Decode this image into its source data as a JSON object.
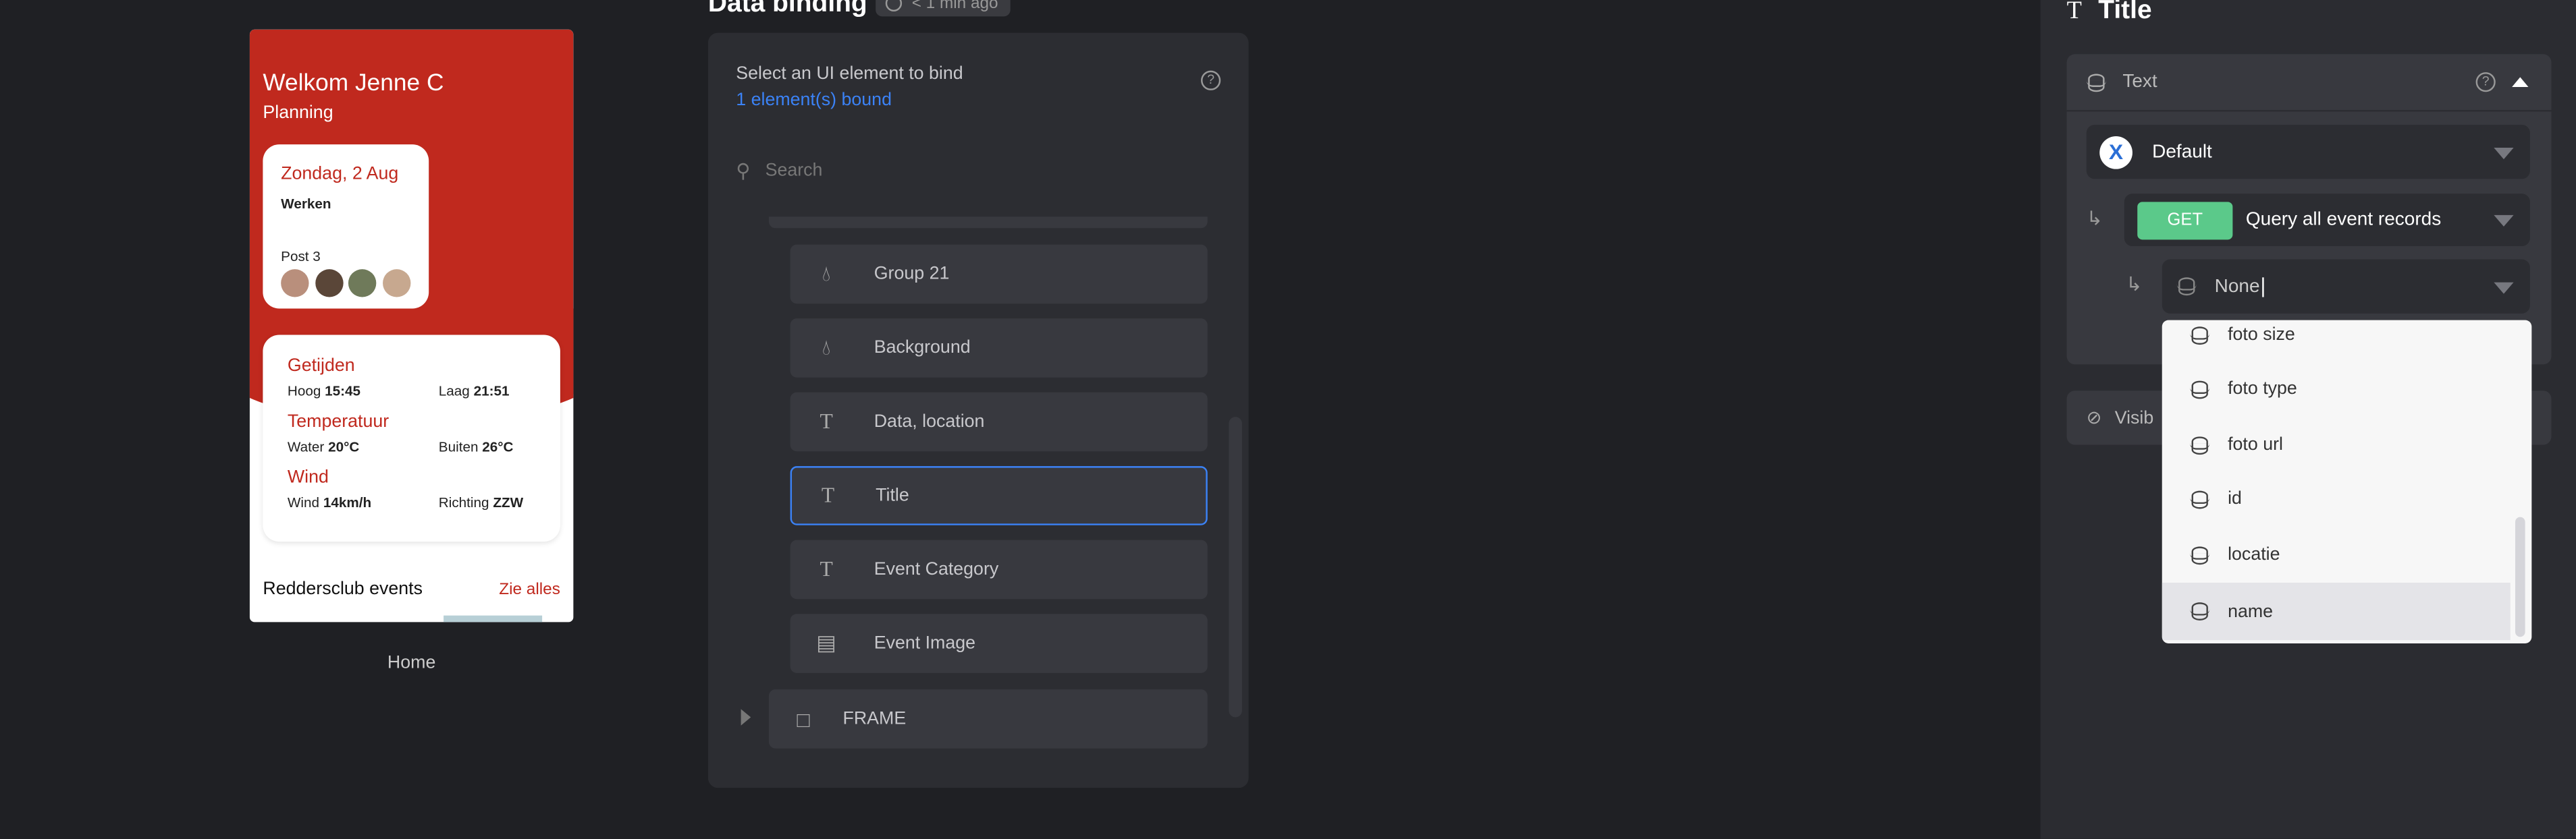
{
  "phone": {
    "greeting": "Welkom Jenne C",
    "subtitle": "Planning",
    "date": "Zondag, 2 Aug",
    "activity": "Werken",
    "post": "Post 3",
    "getijden": {
      "title": "Getijden",
      "hoog_label": "Hoog",
      "hoog": "15:45",
      "laag_label": "Laag",
      "laag": "21:51"
    },
    "temperatuur": {
      "title": "Temperatuur",
      "water_label": "Water",
      "water": "20°C",
      "buiten_label": "Buiten",
      "buiten": "26°C"
    },
    "wind": {
      "title": "Wind",
      "wind_label": "Wind",
      "wind": "14km/h",
      "richting_label": "Richting",
      "richting": "ZZW"
    },
    "events_title": "Reddersclub events",
    "see_all": "Zie alles",
    "screen_label": "Home"
  },
  "binding": {
    "title": "Data binding",
    "saved": "< 1 min ago",
    "instruction": "Select an UI element to bind",
    "bound_count": "1 element(s) bound",
    "search_placeholder": "Search",
    "items": [
      {
        "label": "Group 21",
        "icon": "drop-icon"
      },
      {
        "label": "Background",
        "icon": "drop-icon"
      },
      {
        "label": "Data, location",
        "icon": "text-icon"
      },
      {
        "label": "Title",
        "icon": "text-icon",
        "selected": true
      },
      {
        "label": "Event Category",
        "icon": "text-icon"
      },
      {
        "label": "Event Image",
        "icon": "image-icon"
      }
    ],
    "frame_label": "FRAME"
  },
  "inspector": {
    "title": "Title",
    "section": "Text",
    "source": "Default",
    "method": "GET",
    "query": "Query all event records",
    "field_value": "None",
    "visibility": "Visib",
    "options": [
      "foto size",
      "foto type",
      "foto url",
      "id",
      "locatie",
      "name"
    ],
    "highlighted_option": "name"
  },
  "colors": {
    "brand_red": "#c0291e",
    "accent_blue": "#3b82f6",
    "get_green": "#5bc98a"
  }
}
